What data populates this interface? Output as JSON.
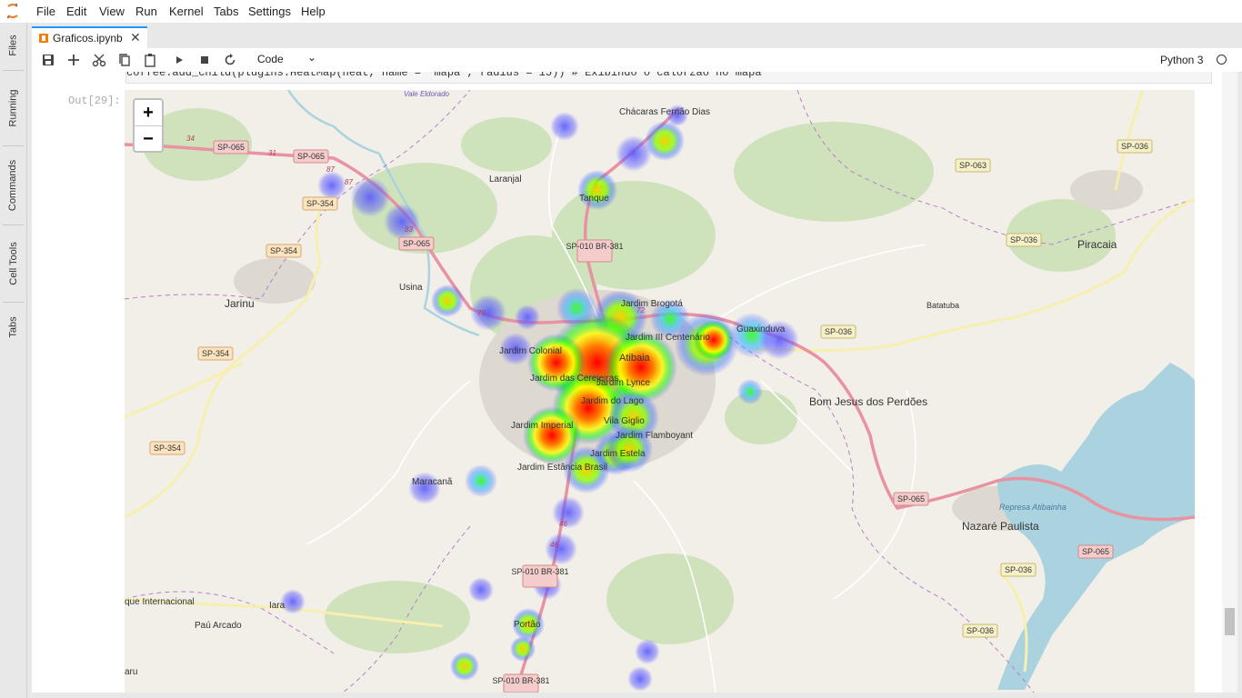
{
  "menubar": {
    "items": [
      "File",
      "Edit",
      "View",
      "Run",
      "Kernel",
      "Tabs",
      "Settings",
      "Help"
    ]
  },
  "left_sidebar": {
    "tabs": [
      "Files",
      "Running",
      "Commands",
      "Cell Tools",
      "Tabs"
    ]
  },
  "notebook_tab": {
    "title": "Graficos.ipynb",
    "close_icon": "close-icon"
  },
  "toolbar": {
    "icons": [
      "save-icon",
      "add-cell-icon",
      "cut-icon",
      "copy-icon",
      "paste-icon",
      "run-icon",
      "stop-icon",
      "restart-icon"
    ],
    "cell_type": "Code",
    "kernel_name": "Python 3"
  },
  "cell": {
    "code_partial": "coffee.add_child(plugins.HeatMap(heat, name = 'mapa', radius = 15)) # Exibindo o calorzão no mapa",
    "out_prompt": "Out[29]:"
  },
  "map": {
    "zoom_in_label": "+",
    "zoom_out_label": "−",
    "place_labels": [
      "Vale Eldorado",
      "Chácaras Fernão Dias",
      "Laranjal",
      "Tanque",
      "Jarinu",
      "Usina",
      "Jardim Brogotá",
      "Jardim III Centenário",
      "Guaxinduva",
      "Batatuba",
      "Jardim Colonial",
      "Jardim das Cerejeiras",
      "Jardim Lynce",
      "Jardim do Lago",
      "Bom Jesus dos Perdões",
      "Vila Giglio",
      "Jardim Flamboyant",
      "Jardim Estela",
      "Jardim Imperial",
      "Jardim Estância Brasil",
      "Maracanã",
      "Piracaia",
      "Nazaré Paulista",
      "Represa Atibainha",
      "Iara",
      "Paú Arcado",
      "que Internacional",
      "Portão",
      "aru",
      "Atibaia"
    ],
    "road_labels": [
      "SP-065",
      "SP-354",
      "SP-010 BR-381",
      "SP-036",
      "SP-063"
    ],
    "route_numbers": [
      "34",
      "31",
      "87",
      "83",
      "79",
      "72",
      "46"
    ],
    "heat_colors": {
      "low": "#3f3fff",
      "mid": "#00ff00",
      "high": "#ffff00",
      "peak": "#ff0000"
    }
  }
}
